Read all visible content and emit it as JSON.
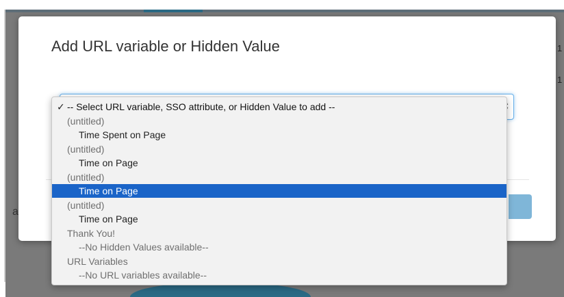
{
  "dialog": {
    "title": "Add URL variable or Hidden Value",
    "select_placeholder": "-- Select URL variable, SSO attribute, or Hidden Value to add --"
  },
  "background": {
    "left_letter": "a",
    "right_cells": [
      "1",
      "1"
    ]
  },
  "dropdown": {
    "check_glyph": "✓",
    "selected_index": 0,
    "highlighted_index": 6,
    "options": [
      {
        "label": "-- Select URL variable, SSO attribute, or Hidden Value to add --",
        "kind": "selected-first"
      },
      {
        "label": "(untitled)",
        "kind": "group"
      },
      {
        "label": "Time Spent on Page",
        "kind": "item"
      },
      {
        "label": "(untitled)",
        "kind": "group"
      },
      {
        "label": "Time on Page",
        "kind": "item"
      },
      {
        "label": "(untitled)",
        "kind": "group"
      },
      {
        "label": "Time on Page",
        "kind": "item"
      },
      {
        "label": "(untitled)",
        "kind": "group"
      },
      {
        "label": "Time on Page",
        "kind": "item"
      },
      {
        "label": "Thank You!",
        "kind": "group"
      },
      {
        "label": "--No Hidden Values available--",
        "kind": "disabled"
      },
      {
        "label": "URL Variables",
        "kind": "group"
      },
      {
        "label": "--No URL variables available--",
        "kind": "disabled"
      }
    ]
  },
  "colors": {
    "highlight": "#1a64c8",
    "focus_border": "#66afe9",
    "backdrop": "#7a7a7a",
    "accent": "#2b6a85"
  }
}
